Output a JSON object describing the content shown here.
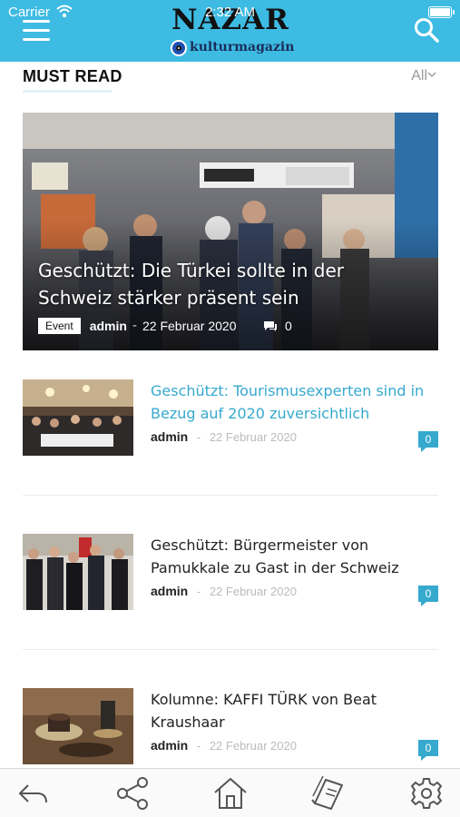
{
  "status_bar": {
    "carrier": "Carrier",
    "time": "2:32 AM"
  },
  "header": {
    "logo_text": "NAZAR",
    "logo_subtitle": "kulturmagazin",
    "menu_icon": "hamburger-menu-icon",
    "search_icon": "search-icon",
    "background_color": "#3dbbe3"
  },
  "section": {
    "title": "MUST READ",
    "filter_label": "All"
  },
  "featured": {
    "title": "Geschützt: Die Türkei sollte in der Schweiz stärker präsent sein",
    "category": "Event",
    "author": "admin",
    "separator": "-",
    "date": "22 Februar 2020",
    "comments": "0"
  },
  "articles": [
    {
      "title": "Geschützt: Tourismusexperten sind in Bezug auf 2020 zuversichtlich",
      "author": "admin",
      "separator": "-",
      "date": "22 Februar 2020",
      "comments": "0"
    },
    {
      "title": "Geschützt: Bürgermeister von Pamukkale zu Gast in der Schweiz",
      "author": "admin",
      "separator": "-",
      "date": "22 Februar 2020",
      "comments": "0"
    },
    {
      "title": "Kolumne: KAFFI TÜRK von Beat Kraushaar",
      "author": "admin",
      "separator": "-",
      "date": "22 Februar 2020",
      "comments": "0"
    }
  ],
  "tabbar": {
    "items": [
      "back-icon",
      "share-icon",
      "home-icon",
      "book-icon",
      "settings-icon"
    ]
  },
  "colors": {
    "accent": "#36a9cf",
    "header": "#3dbbe3"
  }
}
